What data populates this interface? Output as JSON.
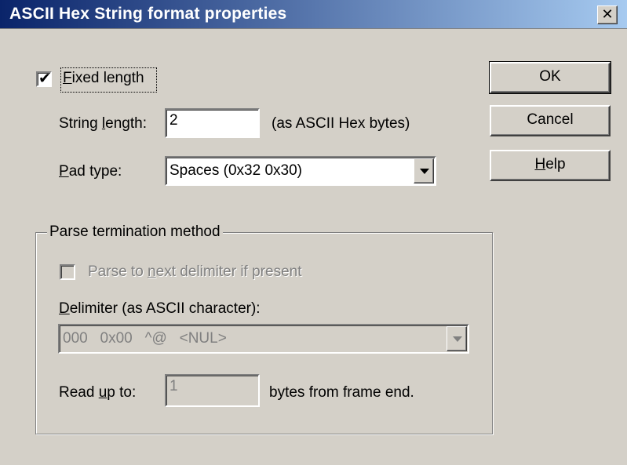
{
  "window": {
    "title": "ASCII Hex String format properties",
    "close_symbol": "✕"
  },
  "fixed_length": {
    "label_pre": "",
    "label_accel": "F",
    "label_rest": "ixed length",
    "checked": true,
    "check_mark": "✔"
  },
  "string_length": {
    "label_pre": "String ",
    "label_accel": "l",
    "label_rest": "ength:",
    "value": "2",
    "suffix": "(as ASCII Hex bytes)"
  },
  "pad_type": {
    "label_pre": "",
    "label_accel": "P",
    "label_rest": "ad type:",
    "value": "Spaces (0x32 0x30)"
  },
  "parse_group": {
    "title": "Parse termination method",
    "next_delim": {
      "label_pre": "Parse to ",
      "label_accel": "n",
      "label_rest": "ext delimiter if present",
      "checked": false
    },
    "delimiter": {
      "label_pre": "",
      "label_accel": "D",
      "label_rest": "elimiter (as ASCII character):",
      "value": "000   0x00   ^@   <NUL>"
    },
    "read_up_to": {
      "label_pre": "Read ",
      "label_accel": "u",
      "label_rest": "p to:",
      "value": "1",
      "suffix": "bytes from frame end."
    }
  },
  "buttons": {
    "ok": "OK",
    "cancel": "Cancel",
    "help_accel": "H",
    "help_rest": "elp"
  }
}
